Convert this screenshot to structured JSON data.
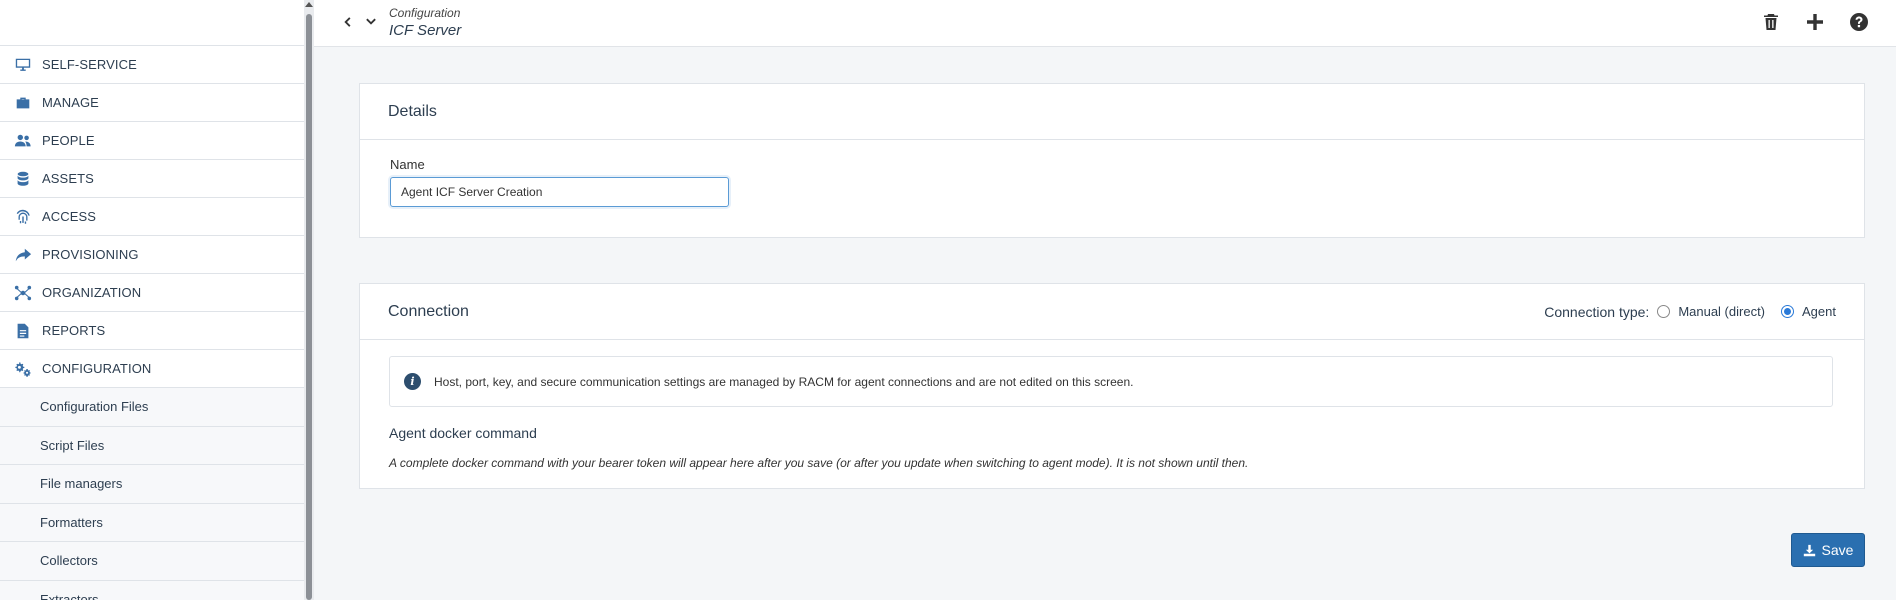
{
  "sidebar": {
    "items": [
      {
        "label": "SELF-SERVICE",
        "icon": "monitor-icon"
      },
      {
        "label": "MANAGE",
        "icon": "toolbox-icon"
      },
      {
        "label": "PEOPLE",
        "icon": "users-icon"
      },
      {
        "label": "ASSETS",
        "icon": "database-icon"
      },
      {
        "label": "ACCESS",
        "icon": "fingerprint-icon"
      },
      {
        "label": "PROVISIONING",
        "icon": "share-arrow-icon"
      },
      {
        "label": "ORGANIZATION",
        "icon": "network-icon"
      },
      {
        "label": "REPORTS",
        "icon": "report-icon"
      },
      {
        "label": "CONFIGURATION",
        "icon": "gears-icon"
      }
    ],
    "sub_items": [
      {
        "label": "Configuration Files"
      },
      {
        "label": "Script Files"
      },
      {
        "label": "File managers"
      },
      {
        "label": "Formatters"
      },
      {
        "label": "Collectors"
      },
      {
        "label": "Extractors"
      }
    ]
  },
  "header": {
    "breadcrumb_parent": "Configuration",
    "title": "ICF Server"
  },
  "details": {
    "title": "Details",
    "name_label": "Name",
    "name_value": "Agent ICF Server Creation"
  },
  "connection": {
    "title": "Connection",
    "type_label": "Connection type:",
    "options": [
      {
        "label": "Manual (direct)",
        "checked": false
      },
      {
        "label": "Agent",
        "checked": true
      }
    ],
    "info_text": "Host, port, key, and secure communication settings are managed by RACM for agent connections and are not edited on this screen.",
    "docker_heading": "Agent docker command",
    "docker_note": "A complete docker command with your bearer token will appear here after you save (or after you update when switching to agent mode). It is not shown until then."
  },
  "actions": {
    "save_label": "Save"
  },
  "colors": {
    "accent": "#2a6fb0",
    "nav_icon": "#3a6fa6"
  }
}
